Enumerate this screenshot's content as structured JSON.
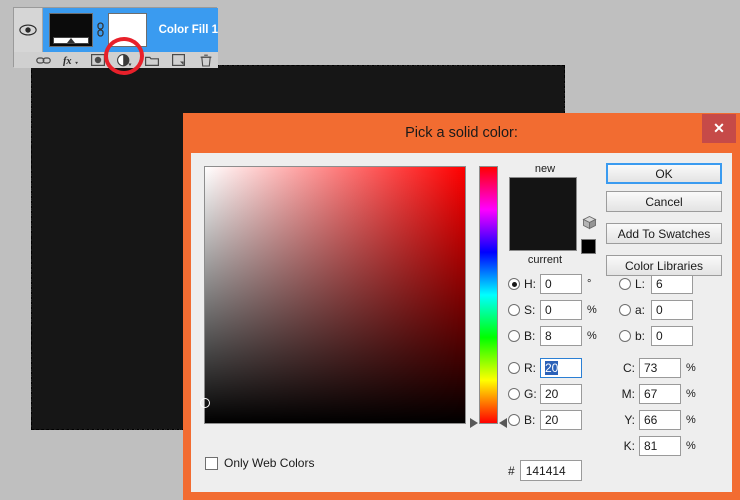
{
  "app": {
    "canvas_background": "#161616",
    "workspace_background": "#bfbfbf"
  },
  "layers_panel": {
    "layer_name": "Color Fill 1",
    "layer_selected": true,
    "eye_icon": "eye-icon",
    "link_icon": "link-icon",
    "thumbnail_color": "#0b0b0b",
    "mask_color": "#ffffff",
    "toolbar_icons": [
      {
        "name": "link-layers-icon",
        "glyph": "∞"
      },
      {
        "name": "layer-style-fx-icon",
        "glyph": "fx"
      },
      {
        "name": "add-layer-mask-icon",
        "glyph": "◎"
      },
      {
        "name": "new-fill-adjustment-layer-icon",
        "glyph": "◐",
        "highlighted": true
      },
      {
        "name": "new-group-icon",
        "glyph": "▭"
      },
      {
        "name": "new-layer-icon",
        "glyph": "⧉"
      },
      {
        "name": "delete-layer-icon",
        "glyph": "🗑"
      }
    ],
    "annotation": "red-circle-highlight"
  },
  "dialog": {
    "title": "Pick a solid color:",
    "close_label": "✕",
    "titlebar_color": "#f26c31",
    "close_button_color": "#c64a48",
    "body_color": "#eeeeee",
    "buttons": [
      {
        "name": "ok-button",
        "label": "OK",
        "primary": true
      },
      {
        "name": "cancel-button",
        "label": "Cancel",
        "primary": false
      },
      {
        "name": "add-to-swatches-button",
        "label": "Add To Swatches",
        "primary": false
      },
      {
        "name": "color-libraries-button",
        "label": "Color Libraries",
        "primary": false
      }
    ],
    "preview": {
      "new_label": "new",
      "current_label": "current",
      "new_color": "#141414",
      "current_color": "#141414",
      "gamut_swatch_color": "#000000"
    },
    "hsb": [
      {
        "name": "hue",
        "label": "H:",
        "value": "0",
        "unit": "°",
        "selected": true
      },
      {
        "name": "saturation",
        "label": "S:",
        "value": "0",
        "unit": "%",
        "selected": false
      },
      {
        "name": "brightness",
        "label": "B:",
        "value": "8",
        "unit": "%",
        "selected": false
      }
    ],
    "rgb": [
      {
        "name": "red",
        "label": "R:",
        "value": "20",
        "unit": "",
        "selected": false,
        "focused": true
      },
      {
        "name": "green",
        "label": "G:",
        "value": "20",
        "unit": "",
        "selected": false,
        "focused": false
      },
      {
        "name": "blue",
        "label": "B:",
        "value": "20",
        "unit": "",
        "selected": false,
        "focused": false
      }
    ],
    "lab": [
      {
        "name": "lab-l",
        "label": "L:",
        "value": "6",
        "unit": "",
        "selected": false
      },
      {
        "name": "lab-a",
        "label": "a:",
        "value": "0",
        "unit": "",
        "selected": false
      },
      {
        "name": "lab-b",
        "label": "b:",
        "value": "0",
        "unit": "",
        "selected": false
      }
    ],
    "cmyk": [
      {
        "name": "cyan",
        "label": "C:",
        "value": "73",
        "unit": "%"
      },
      {
        "name": "magenta",
        "label": "M:",
        "value": "67",
        "unit": "%"
      },
      {
        "name": "yellow",
        "label": "Y:",
        "value": "66",
        "unit": "%"
      },
      {
        "name": "black",
        "label": "K:",
        "value": "81",
        "unit": "%"
      }
    ],
    "hex": {
      "prefix": "#",
      "value": "141414"
    },
    "only_web_colors": {
      "label": "Only Web Colors",
      "checked": false
    },
    "field": {
      "hue_degrees": 0,
      "saturation_pct": 0,
      "brightness_pct": 8
    }
  }
}
